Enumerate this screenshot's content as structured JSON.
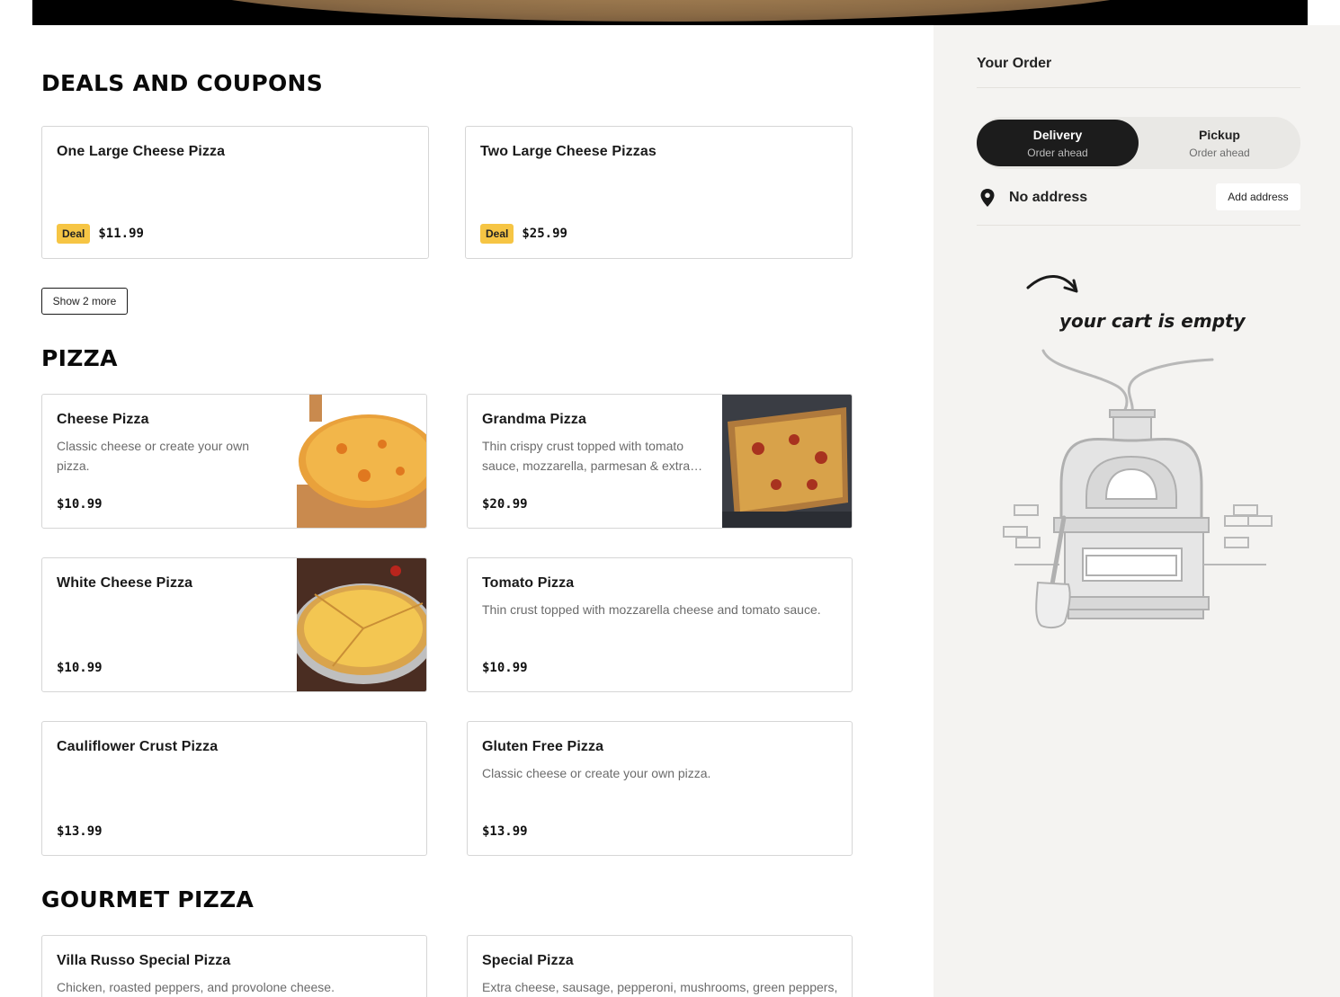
{
  "deals": {
    "title": "DEALS AND COUPONS",
    "items": [
      {
        "name": "One Large Cheese Pizza",
        "badge": "Deal",
        "price": "$11.99"
      },
      {
        "name": "Two Large Cheese Pizzas",
        "badge": "Deal",
        "price": "$25.99"
      }
    ],
    "show_more": "Show 2 more"
  },
  "pizza": {
    "title": "PIZZA",
    "items": [
      {
        "name": "Cheese Pizza",
        "desc": "Classic cheese or create your own pizza.",
        "price": "$10.99",
        "image": "cheese-pizza-photo"
      },
      {
        "name": "Grandma Pizza",
        "desc": "Thin crispy crust topped with tomato sauce, mozzarella, parmesan & extra…",
        "price": "$20.99",
        "image": "grandma-pizza-photo"
      },
      {
        "name": "White Cheese Pizza",
        "desc": "",
        "price": "$10.99",
        "image": "white-cheese-pizza-photo"
      },
      {
        "name": "Tomato Pizza",
        "desc": "Thin crust topped with mozzarella cheese and tomato sauce.",
        "price": "$10.99"
      },
      {
        "name": "Cauliflower Crust Pizza",
        "desc": "",
        "price": "$13.99"
      },
      {
        "name": "Gluten Free Pizza",
        "desc": "Classic cheese or create your own pizza.",
        "price": "$13.99"
      }
    ]
  },
  "gourmet": {
    "title": "GOURMET PIZZA",
    "items": [
      {
        "name": "Villa Russo Special Pizza",
        "desc": "Chicken, roasted peppers, and provolone cheese."
      },
      {
        "name": "Special Pizza",
        "desc": "Extra cheese, sausage, pepperoni, mushrooms, green peppers,"
      }
    ]
  },
  "order": {
    "title": "Your Order",
    "delivery": {
      "label": "Delivery",
      "sub": "Order ahead"
    },
    "pickup": {
      "label": "Pickup",
      "sub": "Order ahead"
    },
    "address": "No address",
    "add_address": "Add address",
    "empty_text": "your cart is empty"
  },
  "colors": {
    "deal_badge": "#f6c544",
    "toggle_active": "#1c1c1c",
    "sidebar_bg": "#f4f3f1"
  }
}
